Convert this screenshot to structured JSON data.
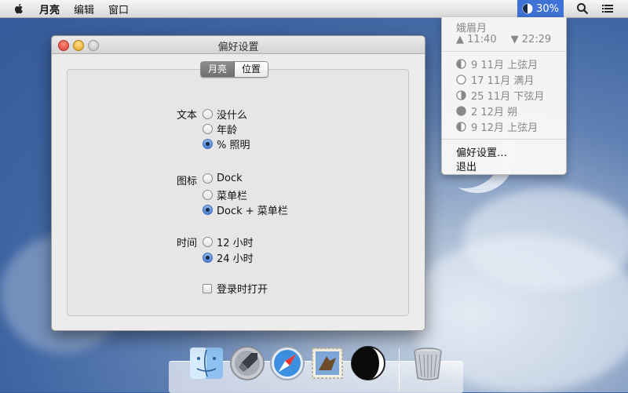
{
  "menubar": {
    "app_name": "月亮",
    "menus": [
      "编辑",
      "窗口"
    ],
    "status_percent": "30%"
  },
  "dropdown": {
    "phase_name": "娥眉月",
    "rise_time": "▲ 11:40",
    "set_time": "▼ 22:29",
    "upcoming": [
      {
        "label": "9 11月 上弦月",
        "icon": "first-quarter-icon"
      },
      {
        "label": "17 11月 满月",
        "icon": "full-moon-icon"
      },
      {
        "label": "25 11月 下弦月",
        "icon": "last-quarter-icon"
      },
      {
        "label": "2 12月 朔",
        "icon": "new-moon-icon"
      },
      {
        "label": "9 12月 上弦月",
        "icon": "first-quarter-icon"
      }
    ],
    "preferences": "偏好设置…",
    "quit": "退出"
  },
  "window": {
    "title": "偏好设置",
    "tabs": [
      {
        "label": "月亮",
        "selected": true
      },
      {
        "label": "位置",
        "selected": false
      }
    ],
    "text_group": {
      "label": "文本",
      "options": [
        {
          "label": "没什么",
          "selected": false
        },
        {
          "label": "年龄",
          "selected": false
        },
        {
          "label": "% 照明",
          "selected": true
        }
      ]
    },
    "icon_group": {
      "label": "图标",
      "options": [
        {
          "label": "Dock",
          "selected": false
        },
        {
          "label": "菜单栏",
          "selected": false
        },
        {
          "label": "Dock + 菜单栏",
          "selected": true
        }
      ]
    },
    "time_group": {
      "label": "时间",
      "options": [
        {
          "label": "12 小时",
          "selected": false
        },
        {
          "label": "24 小时",
          "selected": true
        }
      ]
    },
    "open_at_login": {
      "label": "登录时打开",
      "checked": false
    }
  },
  "dock": {
    "items": [
      "finder-icon",
      "launchpad-icon",
      "safari-icon",
      "mail-icon",
      "moon-app-icon",
      "trash-icon"
    ]
  }
}
